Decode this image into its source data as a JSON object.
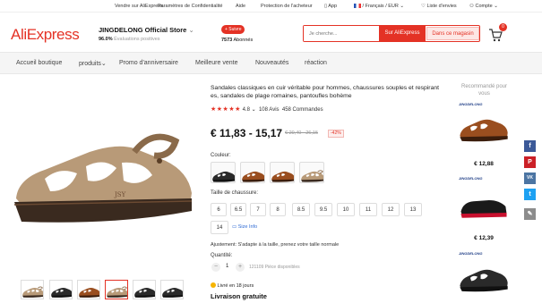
{
  "topbar": {
    "sell": "Vendre sur AliExpress",
    "privacy": "Paramètres de Confidentialité",
    "help": "Aide",
    "protection": "Protection de l'acheteur",
    "app": "App",
    "locale": "/ Français / EUR",
    "wishlist": "Liste d'envies",
    "account": "Compte"
  },
  "header": {
    "logo": "AliExpress",
    "store_name": "JINGDELONG Official Store",
    "store_positive_value": "96.0%",
    "store_positive_text": "Évaluations positives",
    "follow_label": "+ Suivre",
    "followers_value": "7573",
    "followers_text": "Abonnés",
    "search_placeholder": "Je cherche...",
    "search_ae": "Sur AliExpress",
    "search_store": "Dans ce magasin",
    "cart_count": "0"
  },
  "nav": {
    "items": [
      "Accueil boutique",
      "produits",
      "Promo d'anniversaire",
      "Meilleure vente",
      "Nouveautés",
      "réaction"
    ]
  },
  "product": {
    "title": "Sandales classiques en cuir véritable pour hommes, chaussures souples et respirant es, sandales de plage romaines, pantoufles bohème",
    "stars": "★★★★★",
    "rating": "4.8",
    "reviews": "108 Avis",
    "orders": "458 Commandes",
    "price": "€ 11,83 - 15,17",
    "old_price": "€ 20,40 - 26,15",
    "discount": "-42%",
    "color_label": "Couleur:",
    "size_label": "Taille de chaussure:",
    "sizes": [
      "6",
      "6.5",
      "7",
      "8",
      "8.5",
      "9.5",
      "10",
      "11",
      "12",
      "13",
      "14"
    ],
    "size_info": "Size Info",
    "adjust": "Ajustement: S'adapte à la taille, prenez votre taille normale",
    "qty_label": "Quantité:",
    "qty_value": "1",
    "qty_available": "121109 Pièce disponibles",
    "delivery": "Livré en 18 jours",
    "free_shipping": "Livraison gratuite"
  },
  "recommended": {
    "title": "Recommandé pour vous",
    "brand": "JINGDELONG",
    "prices": [
      "€ 12,88",
      "€ 12,39",
      ""
    ]
  },
  "colors": {
    "accent": "#e43225",
    "facebook": "#3b5998",
    "pinterest": "#cb2027",
    "vk": "#4c75a3",
    "twitter": "#1da1f2",
    "edit": "#8c8c8c"
  }
}
